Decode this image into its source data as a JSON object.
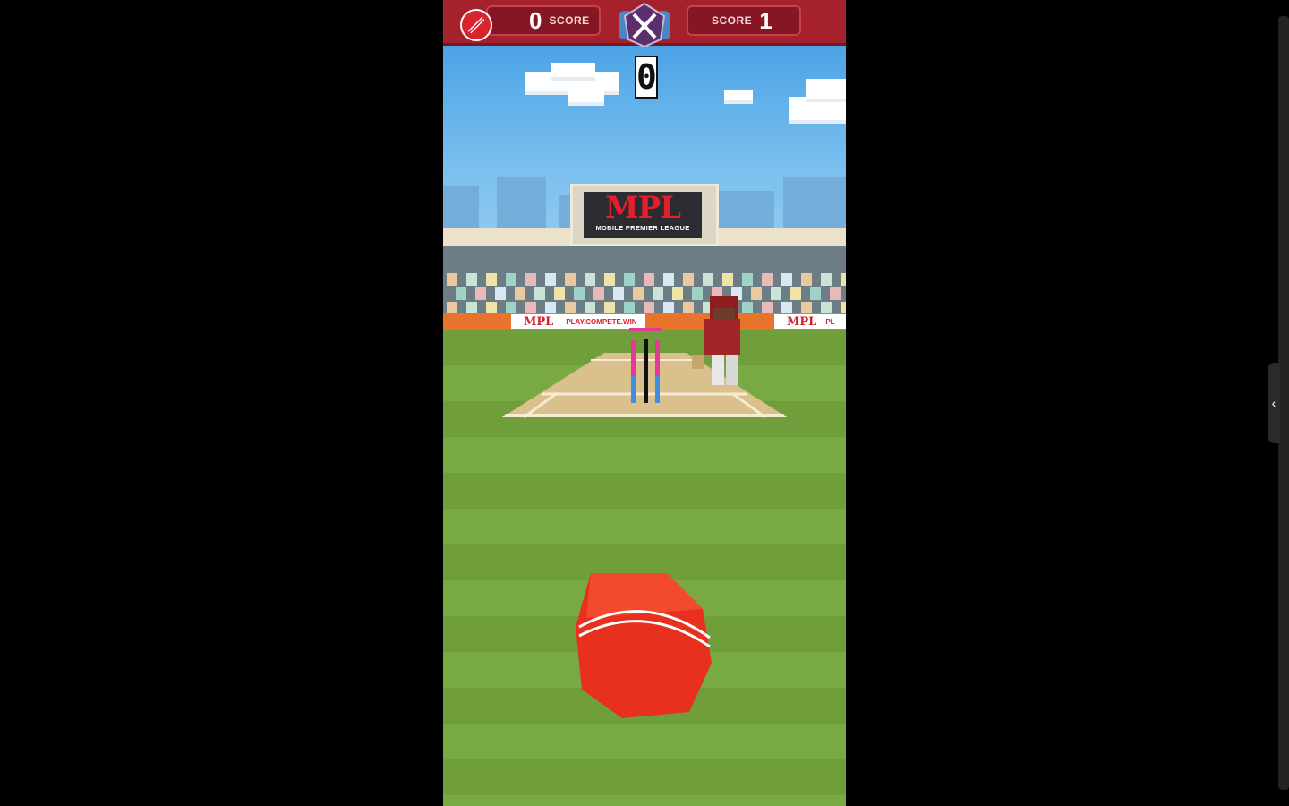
{
  "game": {
    "title": "Cricket",
    "score_left": {
      "value": "0",
      "label": "SCORE"
    },
    "score_right": {
      "label": "SCORE",
      "value": "1"
    },
    "runs_this_ball": "0"
  },
  "stadium": {
    "scoreboard_logo": "MPL",
    "scoreboard_tagline": "MOBILE PREMIER LEAGUE",
    "ad_logo": "MPL",
    "ad_slogan": "PLAY.COMPETE.WIN",
    "ad_logo_right": "MPL",
    "ad_partial": "PL"
  },
  "colors": {
    "topbar": "#a5222c",
    "ball": "#e8301f",
    "pitch": "#d9c08c",
    "grass": "#78a942"
  },
  "icons": {
    "ball_counter": "cricket-ball-icon",
    "vs_badge": "crossed-bats-icon",
    "side_tab": "chevron-left-icon"
  }
}
